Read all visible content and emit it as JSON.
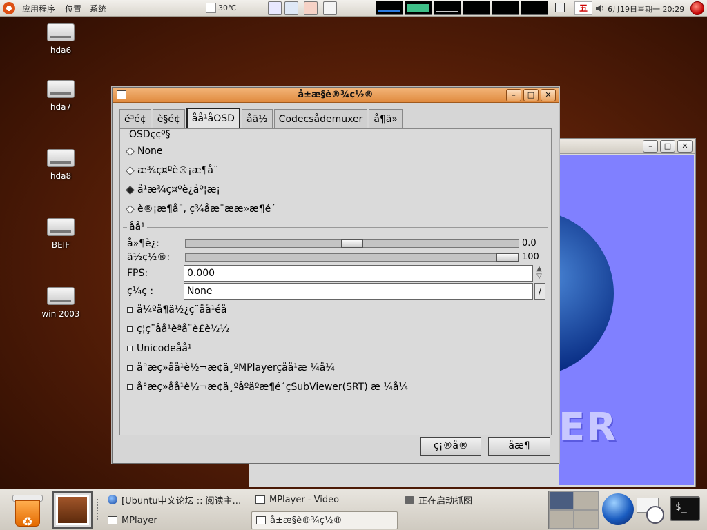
{
  "top_panel": {
    "menus": [
      "应用程序",
      "位置",
      "系统"
    ],
    "weather_temp": "30℃",
    "day": "五",
    "clock": "6月19日星期一 20:29"
  },
  "desktop_icons": [
    "hda6",
    "hda7",
    "hda8",
    "BEIF",
    "win 2003"
  ],
  "dialog": {
    "title": "å±æ§è®¾ç½®",
    "tabs": [
      "é³é¢",
      "è§é¢",
      "å­å¹åOSD",
      "å­ä½",
      "Codecsådemuxer",
      "å¶ä»"
    ],
    "osd_frame_label": "OSDç­çº§",
    "osd_options": [
      "None",
      "æ¾ç¤ºè®¡æ¶å¨",
      "å¹æ¾ç¤ºè¿åº¦æ¡",
      "è®¡æ¶å¨, ç¾åæ¯ææ»æ¶é´"
    ],
    "osd_selected_index": 2,
    "subtitle_frame_label": "å­å¹",
    "delay_label": "å»¶è¿:",
    "delay_value": "0.0",
    "delay_fraction": 0.5,
    "position_label": "ä½ç½®:",
    "position_value": "100",
    "position_fraction": 1.0,
    "fps_label": "FPS:",
    "fps_value": "0.000",
    "encoding_label": "ç¼ç :",
    "encoding_value": "None",
    "checkboxes": [
      "å¼ºå¶ä½¿ç¨å­å¹éå",
      "ç¦ç¨å­å¹èªå¨è£è½½",
      "Unicodeå­å¹",
      "å°æç»å­å¹è½¬æ¢ä¸ºMPlayerçå­å¹æ ¼å¼",
      "å°æç»å­å¹è½¬æ¢ä¸ºåºäºæ¶é´çSubViewer(SRT) æ ¼å¼"
    ],
    "ok_label": "ç¡®å®",
    "cancel_label": "åæ¶"
  },
  "bottom_panel": {
    "tasks": [
      "[Ubuntu中文论坛 :: 阅读主...",
      "MPlayer - Video",
      "正在启动抓图",
      "MPlayer",
      "å±æ§è®¾ç½®"
    ],
    "terminal_prompt": "$_"
  }
}
